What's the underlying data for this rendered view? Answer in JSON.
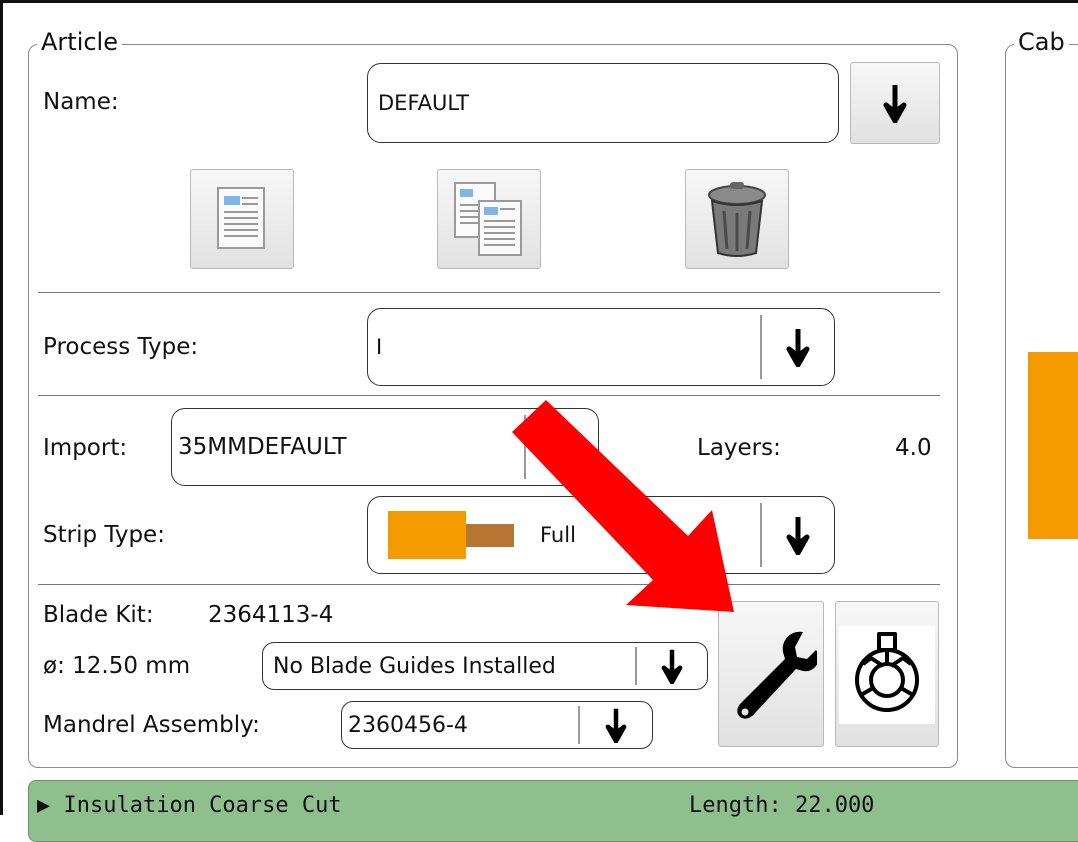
{
  "article": {
    "group_title": "Article",
    "name_label": "Name:",
    "name_value": "DEFAULT",
    "process_label": "Process Type:",
    "process_value": "I",
    "import_label": "Import:",
    "import_value": "35MMDEFAULT",
    "layers_label": "Layers:",
    "layers_value": "4.0",
    "strip_label": "Strip Type:",
    "strip_value": "Full",
    "blade_kit_label": "Blade Kit:",
    "blade_kit_value": "2364113-4",
    "diameter_label": "ø: 12.50 mm",
    "blade_guides_value": "No Blade Guides Installed",
    "mandrel_label": "Mandrel Assembly:",
    "mandrel_value": "2360456-4"
  },
  "cable": {
    "group_title": "Cab"
  },
  "status_row": {
    "left_text": "▶ Insulation   Coarse Cut",
    "right_text": "Length:   22.000"
  },
  "colors": {
    "strip_orange": "#f59b00",
    "strip_brown": "#b87433",
    "arrow_red": "#ff0000",
    "panel_green": "#8fbf8c"
  },
  "icons": {
    "dropdown": "down-arrow-icon",
    "new": "new-document-icon",
    "copy": "copy-document-icon",
    "delete": "trash-icon",
    "tool": "wrench-icon",
    "mandrel": "mandrel-icon"
  }
}
